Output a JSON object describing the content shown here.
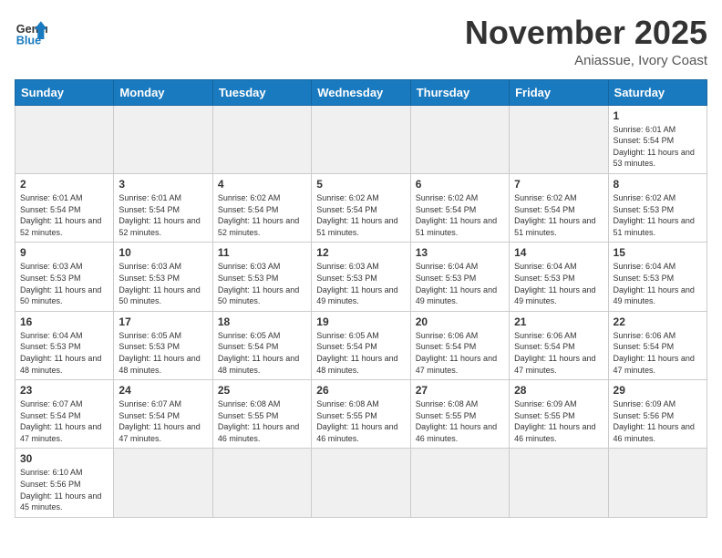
{
  "header": {
    "logo_general": "General",
    "logo_blue": "Blue",
    "month_title": "November 2025",
    "subtitle": "Aniassue, Ivory Coast"
  },
  "weekdays": [
    "Sunday",
    "Monday",
    "Tuesday",
    "Wednesday",
    "Thursday",
    "Friday",
    "Saturday"
  ],
  "weeks": [
    [
      {
        "day": "",
        "empty": true
      },
      {
        "day": "",
        "empty": true
      },
      {
        "day": "",
        "empty": true
      },
      {
        "day": "",
        "empty": true
      },
      {
        "day": "",
        "empty": true
      },
      {
        "day": "",
        "empty": true
      },
      {
        "day": "1",
        "sunrise": "Sunrise: 6:01 AM",
        "sunset": "Sunset: 5:54 PM",
        "daylight": "Daylight: 11 hours and 53 minutes."
      }
    ],
    [
      {
        "day": "2",
        "sunrise": "Sunrise: 6:01 AM",
        "sunset": "Sunset: 5:54 PM",
        "daylight": "Daylight: 11 hours and 52 minutes."
      },
      {
        "day": "3",
        "sunrise": "Sunrise: 6:01 AM",
        "sunset": "Sunset: 5:54 PM",
        "daylight": "Daylight: 11 hours and 52 minutes."
      },
      {
        "day": "4",
        "sunrise": "Sunrise: 6:02 AM",
        "sunset": "Sunset: 5:54 PM",
        "daylight": "Daylight: 11 hours and 52 minutes."
      },
      {
        "day": "5",
        "sunrise": "Sunrise: 6:02 AM",
        "sunset": "Sunset: 5:54 PM",
        "daylight": "Daylight: 11 hours and 51 minutes."
      },
      {
        "day": "6",
        "sunrise": "Sunrise: 6:02 AM",
        "sunset": "Sunset: 5:54 PM",
        "daylight": "Daylight: 11 hours and 51 minutes."
      },
      {
        "day": "7",
        "sunrise": "Sunrise: 6:02 AM",
        "sunset": "Sunset: 5:54 PM",
        "daylight": "Daylight: 11 hours and 51 minutes."
      },
      {
        "day": "8",
        "sunrise": "Sunrise: 6:02 AM",
        "sunset": "Sunset: 5:53 PM",
        "daylight": "Daylight: 11 hours and 51 minutes."
      }
    ],
    [
      {
        "day": "9",
        "sunrise": "Sunrise: 6:03 AM",
        "sunset": "Sunset: 5:53 PM",
        "daylight": "Daylight: 11 hours and 50 minutes."
      },
      {
        "day": "10",
        "sunrise": "Sunrise: 6:03 AM",
        "sunset": "Sunset: 5:53 PM",
        "daylight": "Daylight: 11 hours and 50 minutes."
      },
      {
        "day": "11",
        "sunrise": "Sunrise: 6:03 AM",
        "sunset": "Sunset: 5:53 PM",
        "daylight": "Daylight: 11 hours and 50 minutes."
      },
      {
        "day": "12",
        "sunrise": "Sunrise: 6:03 AM",
        "sunset": "Sunset: 5:53 PM",
        "daylight": "Daylight: 11 hours and 49 minutes."
      },
      {
        "day": "13",
        "sunrise": "Sunrise: 6:04 AM",
        "sunset": "Sunset: 5:53 PM",
        "daylight": "Daylight: 11 hours and 49 minutes."
      },
      {
        "day": "14",
        "sunrise": "Sunrise: 6:04 AM",
        "sunset": "Sunset: 5:53 PM",
        "daylight": "Daylight: 11 hours and 49 minutes."
      },
      {
        "day": "15",
        "sunrise": "Sunrise: 6:04 AM",
        "sunset": "Sunset: 5:53 PM",
        "daylight": "Daylight: 11 hours and 49 minutes."
      }
    ],
    [
      {
        "day": "16",
        "sunrise": "Sunrise: 6:04 AM",
        "sunset": "Sunset: 5:53 PM",
        "daylight": "Daylight: 11 hours and 48 minutes."
      },
      {
        "day": "17",
        "sunrise": "Sunrise: 6:05 AM",
        "sunset": "Sunset: 5:53 PM",
        "daylight": "Daylight: 11 hours and 48 minutes."
      },
      {
        "day": "18",
        "sunrise": "Sunrise: 6:05 AM",
        "sunset": "Sunset: 5:54 PM",
        "daylight": "Daylight: 11 hours and 48 minutes."
      },
      {
        "day": "19",
        "sunrise": "Sunrise: 6:05 AM",
        "sunset": "Sunset: 5:54 PM",
        "daylight": "Daylight: 11 hours and 48 minutes."
      },
      {
        "day": "20",
        "sunrise": "Sunrise: 6:06 AM",
        "sunset": "Sunset: 5:54 PM",
        "daylight": "Daylight: 11 hours and 47 minutes."
      },
      {
        "day": "21",
        "sunrise": "Sunrise: 6:06 AM",
        "sunset": "Sunset: 5:54 PM",
        "daylight": "Daylight: 11 hours and 47 minutes."
      },
      {
        "day": "22",
        "sunrise": "Sunrise: 6:06 AM",
        "sunset": "Sunset: 5:54 PM",
        "daylight": "Daylight: 11 hours and 47 minutes."
      }
    ],
    [
      {
        "day": "23",
        "sunrise": "Sunrise: 6:07 AM",
        "sunset": "Sunset: 5:54 PM",
        "daylight": "Daylight: 11 hours and 47 minutes."
      },
      {
        "day": "24",
        "sunrise": "Sunrise: 6:07 AM",
        "sunset": "Sunset: 5:54 PM",
        "daylight": "Daylight: 11 hours and 47 minutes."
      },
      {
        "day": "25",
        "sunrise": "Sunrise: 6:08 AM",
        "sunset": "Sunset: 5:55 PM",
        "daylight": "Daylight: 11 hours and 46 minutes."
      },
      {
        "day": "26",
        "sunrise": "Sunrise: 6:08 AM",
        "sunset": "Sunset: 5:55 PM",
        "daylight": "Daylight: 11 hours and 46 minutes."
      },
      {
        "day": "27",
        "sunrise": "Sunrise: 6:08 AM",
        "sunset": "Sunset: 5:55 PM",
        "daylight": "Daylight: 11 hours and 46 minutes."
      },
      {
        "day": "28",
        "sunrise": "Sunrise: 6:09 AM",
        "sunset": "Sunset: 5:55 PM",
        "daylight": "Daylight: 11 hours and 46 minutes."
      },
      {
        "day": "29",
        "sunrise": "Sunrise: 6:09 AM",
        "sunset": "Sunset: 5:56 PM",
        "daylight": "Daylight: 11 hours and 46 minutes."
      }
    ],
    [
      {
        "day": "30",
        "sunrise": "Sunrise: 6:10 AM",
        "sunset": "Sunset: 5:56 PM",
        "daylight": "Daylight: 11 hours and 45 minutes."
      },
      {
        "day": "",
        "empty": true
      },
      {
        "day": "",
        "empty": true
      },
      {
        "day": "",
        "empty": true
      },
      {
        "day": "",
        "empty": true
      },
      {
        "day": "",
        "empty": true
      },
      {
        "day": "",
        "empty": true
      }
    ]
  ]
}
